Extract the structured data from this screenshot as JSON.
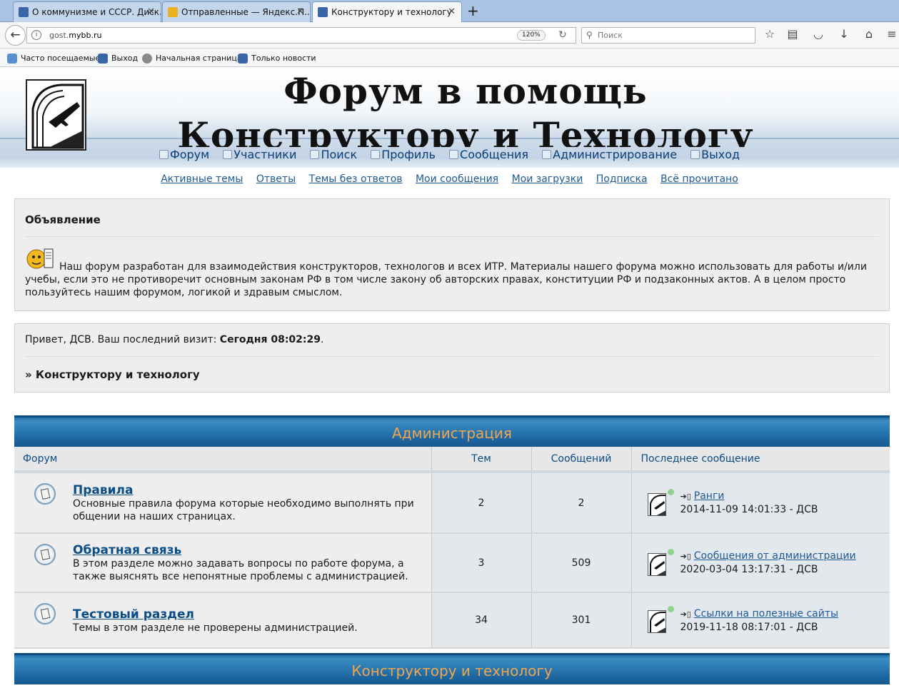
{
  "browser": {
    "tabs": [
      {
        "label": "О коммунизме и СССР. Диск...",
        "active": false
      },
      {
        "label": "Отправленные — Яндекс.П...",
        "active": false
      },
      {
        "label": "Конструктору и технологу",
        "active": true
      }
    ],
    "url_host_prefix": "gost.",
    "url_host_domain": "mybb.ru",
    "zoom": "120%",
    "search_placeholder": "Поиск",
    "bookmarks": [
      "Часто посещаемые",
      "Выход",
      "Начальная страница",
      "Только новости"
    ]
  },
  "banner": {
    "title_line1": "Форум в помощь",
    "title_line2": "Конструктору и Технологу"
  },
  "main_nav": [
    "Форум",
    "Участники",
    "Поиск",
    "Профиль",
    "Сообщения",
    "Администрирование",
    "Выход"
  ],
  "sub_nav": [
    "Активные темы",
    "Ответы",
    "Темы без ответов",
    "Мои сообщения",
    "Мои загрузки",
    "Подписка",
    "Всё прочитано"
  ],
  "announcement": {
    "heading": "Объявление",
    "text": "Наш форум разработан для взаимодействия конструкторов, технологов и всех ИТР. Материалы нашего форума можно использовать для работы и/или учебы, если это не противоречит основным законам РФ в том числе закону об авторских правах, конституции РФ и подзаконных актов. А в целом просто пользуйтесь нашим форумом, логикой и здравым смыслом."
  },
  "welcome": {
    "greeting_prefix": "Привет, ",
    "user": "ДСВ",
    "last_visit_label": ".   Ваш последний визит: ",
    "last_visit_value": "Сегодня 08:02:29",
    "last_visit_suffix": ".",
    "breadcrumb": "» Конструктору и технологу"
  },
  "categories": [
    "Администрация",
    "Конструктору и технологу"
  ],
  "table": {
    "headers": [
      "Форум",
      "Тем",
      "Сообщений",
      "Последнее сообщение"
    ],
    "rows": [
      {
        "name": "Правила",
        "desc": "Основные правила форума которые необходимо выполнять при общении на наших страницах.",
        "topics": "2",
        "posts": "2",
        "last_title": "Ранги",
        "last_meta": "2014-11-09 14:01:33 - ДСВ"
      },
      {
        "name": "Обратная связь",
        "desc": "В этом разделе можно задавать вопросы по работе форума, а также выяснять все непонятные проблемы с администрацией.",
        "topics": "3",
        "posts": "509",
        "last_title": "Сообщения от администрации",
        "last_meta": "2020-03-04 13:17:31 - ДСВ"
      },
      {
        "name": "Тестовый раздел",
        "desc": "Темы в этом разделе не проверены администрацией.",
        "topics": "34",
        "posts": "301",
        "last_title": "Ссылки на полезные сайты",
        "last_meta": "2019-11-18 08:17:01 - ДСВ"
      }
    ]
  },
  "colors": {
    "category_text": "#f0a64d",
    "category_bg": "#2a79b2",
    "link": "#0b4e87"
  }
}
